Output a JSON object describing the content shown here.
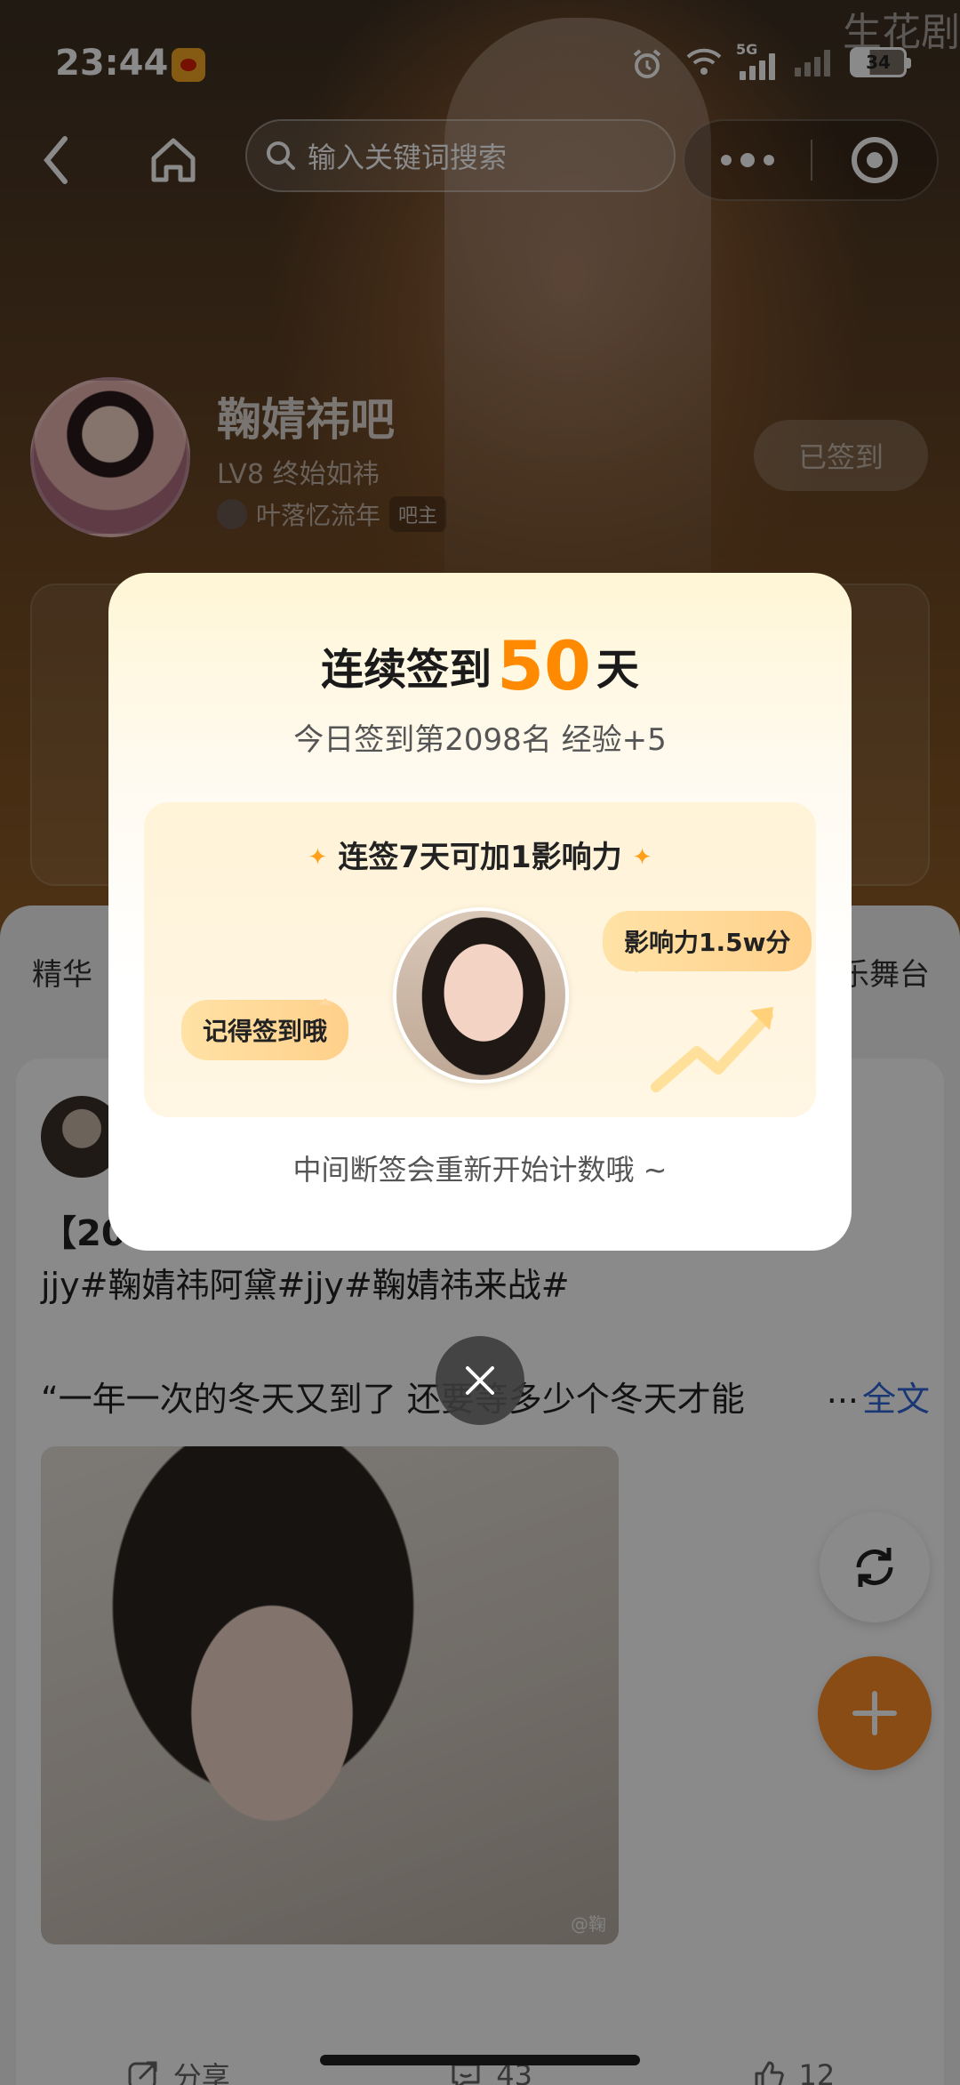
{
  "status_bar": {
    "time": "23:44",
    "network_label": "5G",
    "battery": "34",
    "brand_watermark": "生花剧"
  },
  "top_nav": {
    "search_placeholder": "输入关键词搜索"
  },
  "forum": {
    "name": "鞠婧祎吧",
    "level": "LV8 终始如祎",
    "owner_name": "叶落忆流年",
    "owner_tag": "吧主",
    "signed_label": "已签到"
  },
  "tabs": [
    "精华",
    "乐舞台"
  ],
  "post": {
    "title_fragment": "【20",
    "tags": "jjy#鞠婧祎阿黛#jjy#鞠婧祎来战#",
    "excerpt": "“一年一次的冬天又到了 还要等多少个冬天才能",
    "ellipsis": "...",
    "more_label": "全文",
    "image_watermark": "@鞠",
    "share_label": "分享",
    "comment_count": "43",
    "like_count": "12"
  },
  "checkin_modal": {
    "title_prefix": "连续签到",
    "streak_days": "50",
    "title_suffix": "天",
    "subtitle": "今日签到第2098名 经验+5",
    "reward_heading": "连签7天可加1影响力",
    "bubble_left": "记得签到哦",
    "bubble_right": "影响力1.5w分",
    "footer_note": "中间断签会重新开始计数哦 ~"
  },
  "colors": {
    "accent": "#ff8a00",
    "fab": "#ff8c28",
    "link": "#2f66d6"
  },
  "icons": [
    "back-icon",
    "home-icon",
    "search-icon",
    "more-dots-icon",
    "target-icon",
    "refresh-icon",
    "plus-icon",
    "close-icon",
    "share-icon",
    "comment-icon",
    "like-icon",
    "sparkle-icon",
    "trend-arrow-icon"
  ]
}
